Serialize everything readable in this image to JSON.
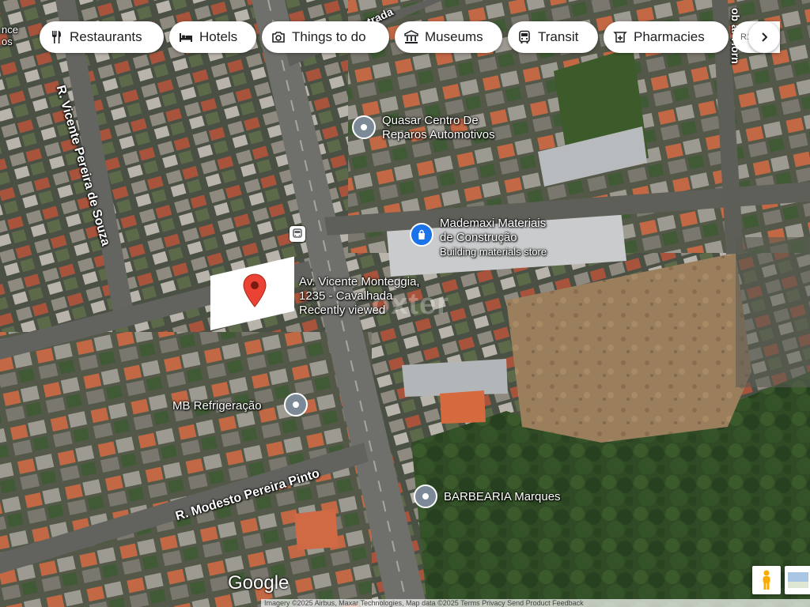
{
  "chips": [
    {
      "label": "Restaurants",
      "icon": "fork-knife-icon"
    },
    {
      "label": "Hotels",
      "icon": "bed-icon"
    },
    {
      "label": "Things to do",
      "icon": "camera-icon"
    },
    {
      "label": "Museums",
      "icon": "museum-icon"
    },
    {
      "label": "Transit",
      "icon": "bus-icon"
    },
    {
      "label": "Pharmacies",
      "icon": "pharmacy-icon"
    }
  ],
  "chip_partial_label": "R1",
  "scroll_icon": "chevron-right-icon",
  "roads": {
    "vicente_pereira": "R. Vicente Pereira de Souza",
    "modesto_pereira": "R. Modesto Pereira Pinto",
    "estrada_fragment": "Estrada",
    "horn_fragment": "ob    ar Horn",
    "top_left_fragment": "nce\nos"
  },
  "pois": {
    "quasar": {
      "name_line1": "Quasar Centro De",
      "name_line2": "Reparos Automotivos"
    },
    "mademaxi": {
      "name_line1": "Mademaxi Materiais",
      "name_line2": "de Construção",
      "category": "Building materials store"
    },
    "mb": {
      "name": "MB Refrigeração"
    },
    "barbearia": {
      "name": "BARBEARIA Marques"
    }
  },
  "selected_place": {
    "address_line1": "Av. Vicente Monteggia,",
    "address_line2": "1235 - Cavalhada",
    "status": "Recently viewed"
  },
  "watermark": "oxter",
  "google_logo": "Google",
  "footer_text": "Imagery ©2025 Airbus, Maxar Technologies, Map data ©2025   Terms   Privacy   Send Product Feedback",
  "colors": {
    "pin_red": "#ea4335",
    "store_blue": "#1a73e8",
    "poi_gray": "#7b8a96"
  }
}
